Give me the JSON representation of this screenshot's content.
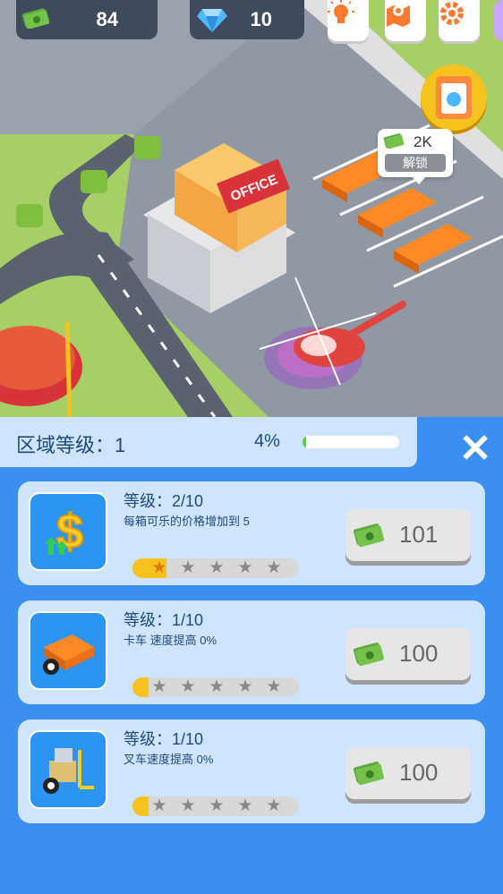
{
  "hud": {
    "cash": "84",
    "gems": "10",
    "buttons": [
      "lightbulb-icon",
      "map-pin-icon",
      "wrench-gear-icon"
    ]
  },
  "scene": {
    "office_sign": "OFFICE",
    "unlock": {
      "amount": "2K",
      "label": "解锁"
    }
  },
  "panel": {
    "title": "区域等级：1",
    "progress_text": "4%",
    "progress": 0.04,
    "upgrades": [
      {
        "level": "等级：2/10",
        "desc": "每箱可乐的价格增加到 5",
        "price": "101",
        "icon": "dollar-upgrade-icon",
        "stars_filled": 1
      },
      {
        "level": "等级：1/10",
        "desc": "卡车 速度提高 0%",
        "price": "100",
        "icon": "truck-speed-icon",
        "stars_filled": 0
      },
      {
        "level": "等级：1/10",
        "desc": "叉车速度提高 0%",
        "price": "100",
        "icon": "forklift-speed-icon",
        "stars_filled": 0
      }
    ]
  },
  "colors": {
    "panel_bg": "#3b8ff0",
    "card_bg": "#cfe4ff",
    "progress_green": "#4cd04c",
    "star_bar": "#f7c21e"
  }
}
